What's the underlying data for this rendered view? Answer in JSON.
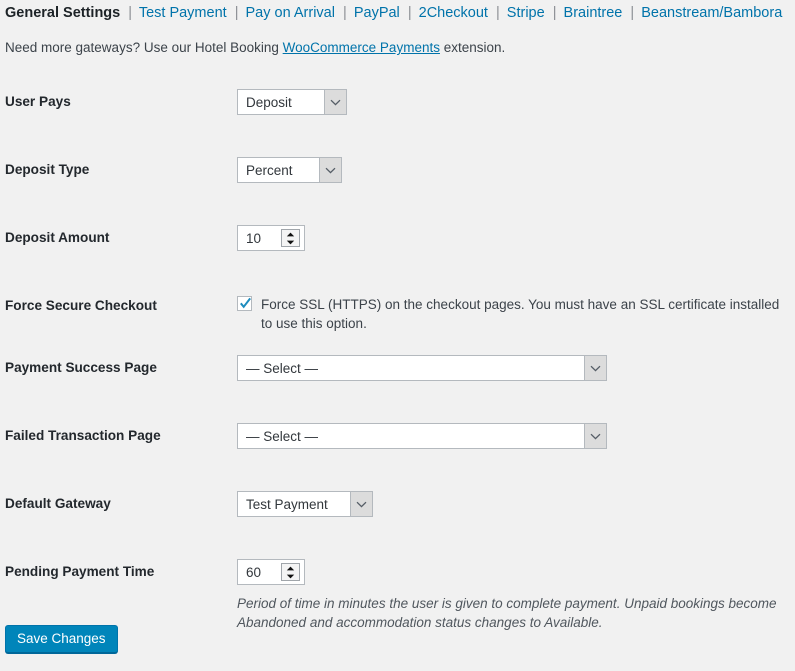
{
  "nav": {
    "separator": "|",
    "items": [
      {
        "label": "General Settings",
        "active": true
      },
      {
        "label": "Test Payment",
        "active": false
      },
      {
        "label": "Pay on Arrival",
        "active": false
      },
      {
        "label": "PayPal",
        "active": false
      },
      {
        "label": "2Checkout",
        "active": false
      },
      {
        "label": "Stripe",
        "active": false
      },
      {
        "label": "Braintree",
        "active": false
      },
      {
        "label": "Beanstream/Bambora",
        "active": false
      }
    ]
  },
  "intro": {
    "before_link": "Need more gateways? Use our Hotel Booking ",
    "link_text": "WooCommerce Payments",
    "after_link": " extension."
  },
  "fields": {
    "user_pays": {
      "label": "User Pays",
      "value": "Deposit"
    },
    "deposit_type": {
      "label": "Deposit Type",
      "value": "Percent"
    },
    "deposit_amount": {
      "label": "Deposit Amount",
      "value": "10"
    },
    "force_secure_checkout": {
      "label": "Force Secure Checkout",
      "checked": true,
      "description": "Force SSL (HTTPS) on the checkout pages. You must have an SSL certificate installed to use this option."
    },
    "payment_success_page": {
      "label": "Payment Success Page",
      "value": "— Select —"
    },
    "failed_transaction_page": {
      "label": "Failed Transaction Page",
      "value": "— Select —"
    },
    "default_gateway": {
      "label": "Default Gateway",
      "value": "Test Payment"
    },
    "pending_payment_time": {
      "label": "Pending Payment Time",
      "value": "60",
      "description": "Period of time in minutes the user is given to complete payment. Unpaid bookings become Abandoned and accommodation status changes to Available."
    }
  },
  "submit": {
    "label": "Save Changes"
  },
  "colors": {
    "background": "#f1f1f1",
    "link": "#0073aa",
    "primary_button": "#0085ba",
    "checkbox_check": "#1e8cbe",
    "label_text": "#23282d"
  }
}
